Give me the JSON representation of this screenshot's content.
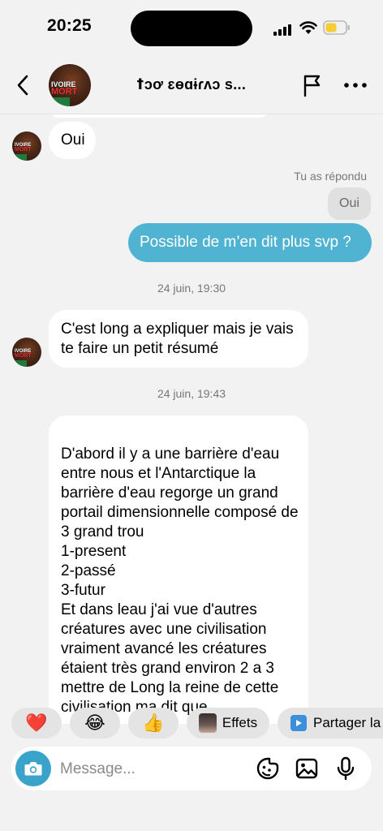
{
  "status_bar": {
    "time": "20:25"
  },
  "header": {
    "contact_name": "ꝉɔơ ɛɵɑɨɾʌɔ s...",
    "avatar_text_top": "IVOIRE",
    "avatar_text_bottom": "MORT"
  },
  "messages": {
    "oui_in": "Oui",
    "reply_note": "Tu as répondu",
    "reply_quote": "Oui",
    "out_1": "Possible de m’en dit plus svp ?",
    "ts_1": "24 juin, 19:30",
    "in_2": "C'est long a expliquer mais je vais te faire un petit résumé",
    "ts_2": "24 juin, 19:43",
    "in_3": "D'abord il y a une barrière d'eau entre nous et l'Antarctique la barrière d'eau regorge un grand portail dimensionnelle composé de 3 grand trou\n1-present\n2-passé\n3-futur\nEt dans leau j'ai vue d'autres créatures avec une civilisation vraiment avancé les créatures étaient très grand environ 2 a 3 mettre de Long la reine de cette civilisation ma dit que"
  },
  "quick_replies": {
    "heart": "❤️",
    "laugh": "😂",
    "thumbs": "👍",
    "effects": "Effets",
    "share": "Partager la"
  },
  "composer": {
    "placeholder": "Message..."
  },
  "colors": {
    "outgoing_bubble": "#4fb3d1",
    "camera_button": "#3aa3c9",
    "background": "#f2f2f2"
  }
}
